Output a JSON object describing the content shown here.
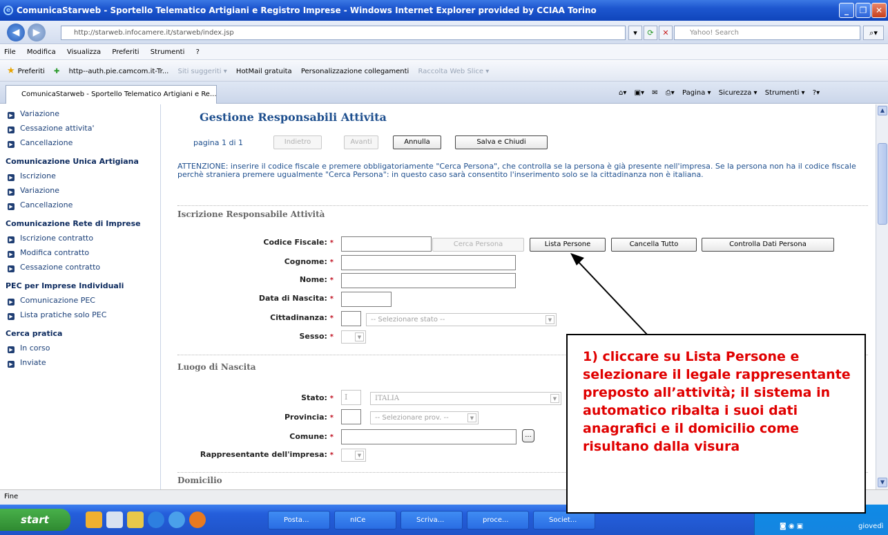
{
  "window": {
    "title": "ComunicaStarweb - Sportello Telematico Artigiani e Registro Imprese - Windows Internet Explorer provided by CCIAA Torino"
  },
  "address": {
    "url": "http://starweb.infocamere.it/starweb/index.jsp",
    "search_placeholder": "Yahoo! Search"
  },
  "menu": [
    "File",
    "Modifica",
    "Visualizza",
    "Preferiti",
    "Strumenti",
    "?"
  ],
  "favorites": {
    "label": "Preferiti",
    "items": [
      "http--auth.pie.camcom.it-Tr...",
      "Siti suggeriti ▾",
      "HotMail gratuita",
      "Personalizzazione collegamenti",
      "Raccolta Web Slice ▾"
    ]
  },
  "tab": {
    "title": "ComunicaStarweb - Sportello Telematico Artigiani e Re..."
  },
  "toolbar_right": [
    "Pagina ▾",
    "Sicurezza ▾",
    "Strumenti ▾"
  ],
  "sidebar": {
    "items_top": [
      "Variazione",
      "Cessazione attivita'",
      "Cancellazione"
    ],
    "sec1": "Comunicazione Unica Artigiana",
    "items_sec1": [
      "Iscrizione",
      "Variazione",
      "Cancellazione"
    ],
    "sec2": "Comunicazione Rete di Imprese",
    "items_sec2": [
      "Iscrizione contratto",
      "Modifica contratto",
      "Cessazione contratto"
    ],
    "sec3": "PEC per Imprese Individuali",
    "items_sec3": [
      "Comunicazione PEC",
      "Lista pratiche solo PEC"
    ],
    "sec4": "Cerca pratica",
    "items_sec4": [
      "In corso",
      "Inviate"
    ]
  },
  "main": {
    "title": "Gestione Responsabili Attivita",
    "page_info": "pagina 1 di 1",
    "buttons": {
      "back": "Indietro",
      "next": "Avanti",
      "cancel": "Annulla",
      "save": "Salva e Chiudi"
    },
    "attention": "ATTENZIONE: inserire il codice fiscale e premere obbligatoriamente \"Cerca Persona\", che controlla se la persona è già presente nell'impresa. Se la persona non ha il codice fiscale perchè straniera premere ugualmente \"Cerca Persona\": in questo caso sarà consentito l'inserimento solo se la cittadinanza non è italiana.",
    "section1": "Iscrizione Responsabile Attività",
    "labels": {
      "cf": "Codice Fiscale:",
      "cognome": "Cognome:",
      "nome": "Nome:",
      "data": "Data di Nascita:",
      "citt": "Cittadinanza:",
      "sesso": "Sesso:"
    },
    "form_buttons": {
      "cerca": "Cerca Persona",
      "lista": "Lista Persone",
      "cancella": "Cancella Tutto",
      "controlla": "Controlla Dati Persona"
    },
    "citt_select": "-- Selezionare stato --",
    "section2": "Luogo di Nascita",
    "labels2": {
      "stato": "Stato:",
      "prov": "Provincia:",
      "comune": "Comune:",
      "rappr": "Rappresentante dell'impresa:"
    },
    "stato_code": "I",
    "stato_select": "ITALIA",
    "prov_select": "-- Selezionare prov. --",
    "comune_btn": "...",
    "section3": "Domicilio",
    "required_mark": "*"
  },
  "status": "Fine",
  "taskbar": {
    "start": "start",
    "tasks": [
      "Posta...",
      "nICe",
      "Scriva...",
      "proce...",
      "Societ..."
    ],
    "tray_text": "giovedì"
  },
  "callout": "1) cliccare su Lista Persone e selezionare il legale rappresentante preposto all’attività; il sistema in automatico ribalta i suoi dati anagrafici e il domicilio come risultano dalla visura"
}
